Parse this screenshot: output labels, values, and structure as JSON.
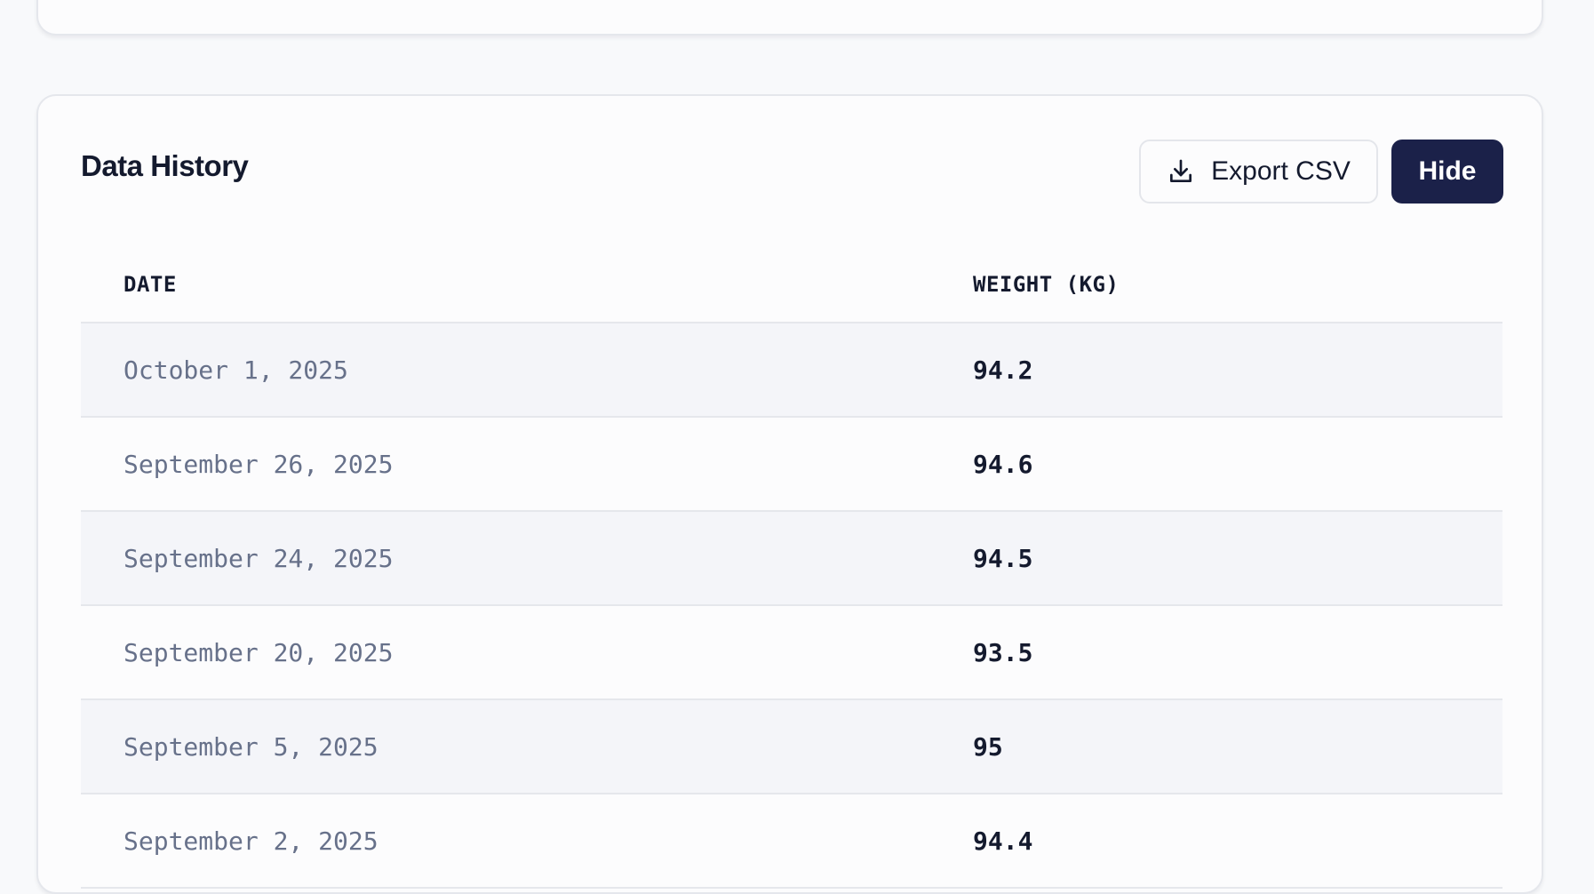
{
  "history": {
    "title": "Data History",
    "export_label": "Export CSV",
    "hide_label": "Hide",
    "columns": {
      "date": "DATE",
      "weight": "WEIGHT (KG)"
    },
    "rows": [
      {
        "date": "October 1, 2025",
        "weight": "94.2"
      },
      {
        "date": "September 26, 2025",
        "weight": "94.6"
      },
      {
        "date": "September 24, 2025",
        "weight": "94.5"
      },
      {
        "date": "September 20, 2025",
        "weight": "93.5"
      },
      {
        "date": "September 5, 2025",
        "weight": "95"
      },
      {
        "date": "September 2, 2025",
        "weight": "94.4"
      }
    ]
  },
  "icons": {
    "export": "download-icon"
  },
  "colors": {
    "primary_button": "#1b2149",
    "text_dark": "#141a2e",
    "text_muted": "#67718a",
    "row_alt": "#f4f5f9",
    "border": "#e5e7ec"
  }
}
